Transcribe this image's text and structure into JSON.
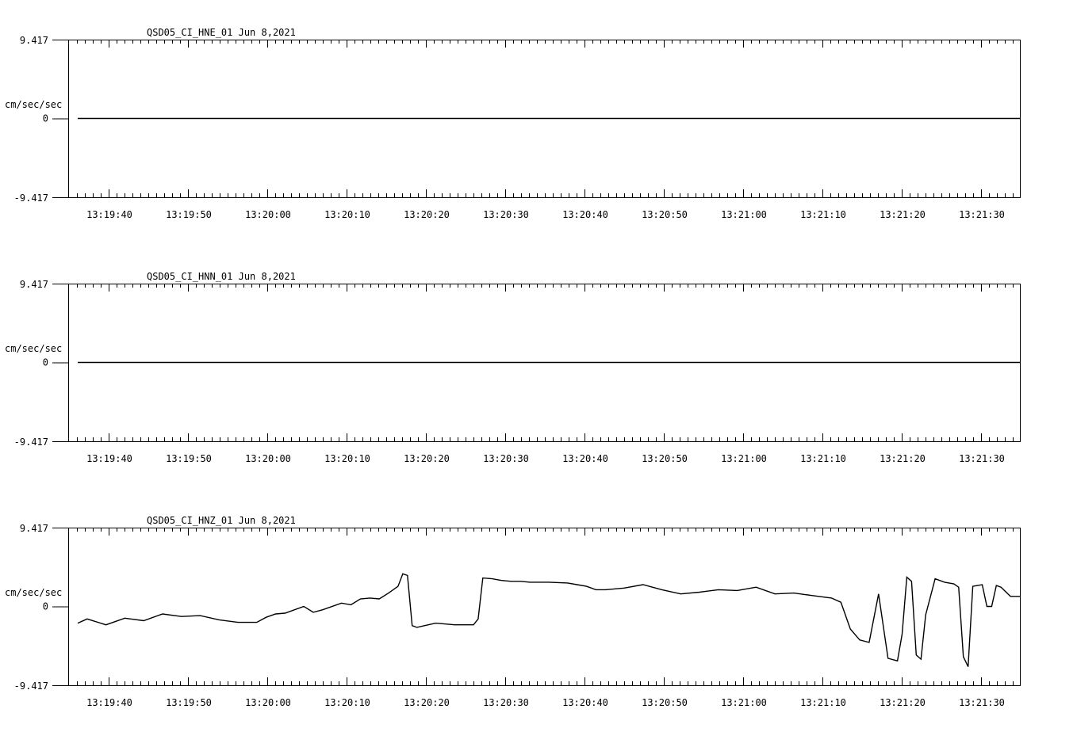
{
  "chart_data": [
    {
      "type": "line",
      "title": "QSD05_CI_HNE_01  Jun 8,2021",
      "ylabel": "cm/sec/sec",
      "ylim": [
        -9.417,
        9.417
      ],
      "y_tick_labels": [
        "9.417",
        "0",
        "-9.417"
      ],
      "x_tick_labels": [
        "13:19:40",
        "13:19:50",
        "13:20:00",
        "13:20:10",
        "13:20:20",
        "13:20:30",
        "13:20:40",
        "13:20:50",
        "13:21:00",
        "13:21:10",
        "13:21:20",
        "13:21:30"
      ],
      "series": [
        {
          "x": [
            0.0,
            1.0
          ],
          "y": [
            0.0,
            0.0
          ]
        }
      ]
    },
    {
      "type": "line",
      "title": "QSD05_CI_HNN_01  Jun 8,2021",
      "ylabel": "cm/sec/sec",
      "ylim": [
        -9.417,
        9.417
      ],
      "y_tick_labels": [
        "9.417",
        "0",
        "-9.417"
      ],
      "x_tick_labels": [
        "13:19:40",
        "13:19:50",
        "13:20:00",
        "13:20:10",
        "13:20:20",
        "13:20:30",
        "13:20:40",
        "13:20:50",
        "13:21:00",
        "13:21:10",
        "13:21:20",
        "13:21:30"
      ],
      "series": [
        {
          "x": [
            0.0,
            1.0
          ],
          "y": [
            0.0,
            0.0
          ]
        }
      ]
    },
    {
      "type": "line",
      "title": "QSD05_CI_HNZ_01  Jun 8,2021",
      "ylabel": "cm/sec/sec",
      "ylim": [
        -9.417,
        9.417
      ],
      "y_tick_labels": [
        "9.417",
        "0",
        "-9.417"
      ],
      "x_tick_labels": [
        "13:19:40",
        "13:19:50",
        "13:20:00",
        "13:20:10",
        "13:20:20",
        "13:20:30",
        "13:20:40",
        "13:20:50",
        "13:21:00",
        "13:21:10",
        "13:21:20",
        "13:21:30"
      ],
      "series": [
        {
          "x": [
            0.0,
            0.01,
            0.03,
            0.05,
            0.07,
            0.09,
            0.11,
            0.13,
            0.15,
            0.17,
            0.19,
            0.2,
            0.21,
            0.22,
            0.24,
            0.25,
            0.26,
            0.28,
            0.29,
            0.3,
            0.31,
            0.32,
            0.33,
            0.34,
            0.345,
            0.35,
            0.355,
            0.36,
            0.38,
            0.4,
            0.42,
            0.425,
            0.43,
            0.44,
            0.445,
            0.45,
            0.46,
            0.47,
            0.48,
            0.5,
            0.52,
            0.53,
            0.54,
            0.55,
            0.56,
            0.58,
            0.6,
            0.62,
            0.64,
            0.66,
            0.68,
            0.7,
            0.72,
            0.74,
            0.76,
            0.78,
            0.8,
            0.81,
            0.82,
            0.83,
            0.84,
            0.85,
            0.86,
            0.87,
            0.875,
            0.88,
            0.885,
            0.89,
            0.895,
            0.9,
            0.91,
            0.92,
            0.93,
            0.935,
            0.94,
            0.945,
            0.95,
            0.96,
            0.965,
            0.97,
            0.975,
            0.98,
            0.99,
            1.0
          ],
          "y": [
            -2.0,
            -1.5,
            -2.2,
            -1.4,
            -1.7,
            -0.9,
            -1.2,
            -1.1,
            -1.6,
            -1.9,
            -1.9,
            -1.3,
            -0.9,
            -0.8,
            0.0,
            -0.7,
            -0.4,
            0.4,
            0.2,
            0.9,
            1.0,
            0.9,
            1.6,
            2.4,
            3.9,
            3.7,
            -2.3,
            -2.5,
            -2.0,
            -2.2,
            -2.2,
            -1.5,
            3.4,
            3.3,
            3.2,
            3.1,
            3.0,
            3.0,
            2.9,
            2.9,
            2.8,
            2.6,
            2.4,
            2.0,
            2.0,
            2.2,
            2.6,
            2.0,
            1.5,
            1.7,
            2.0,
            1.9,
            2.3,
            1.5,
            1.6,
            1.3,
            1.0,
            0.5,
            -2.7,
            -4.0,
            -4.3,
            1.5,
            -6.2,
            -6.5,
            -3.3,
            3.5,
            3.0,
            -5.8,
            -6.3,
            -1.0,
            3.3,
            2.9,
            2.7,
            2.3,
            -6.0,
            -7.2,
            2.4,
            2.6,
            0.0,
            0.0,
            2.5,
            2.3,
            1.2,
            1.2
          ]
        }
      ]
    }
  ]
}
